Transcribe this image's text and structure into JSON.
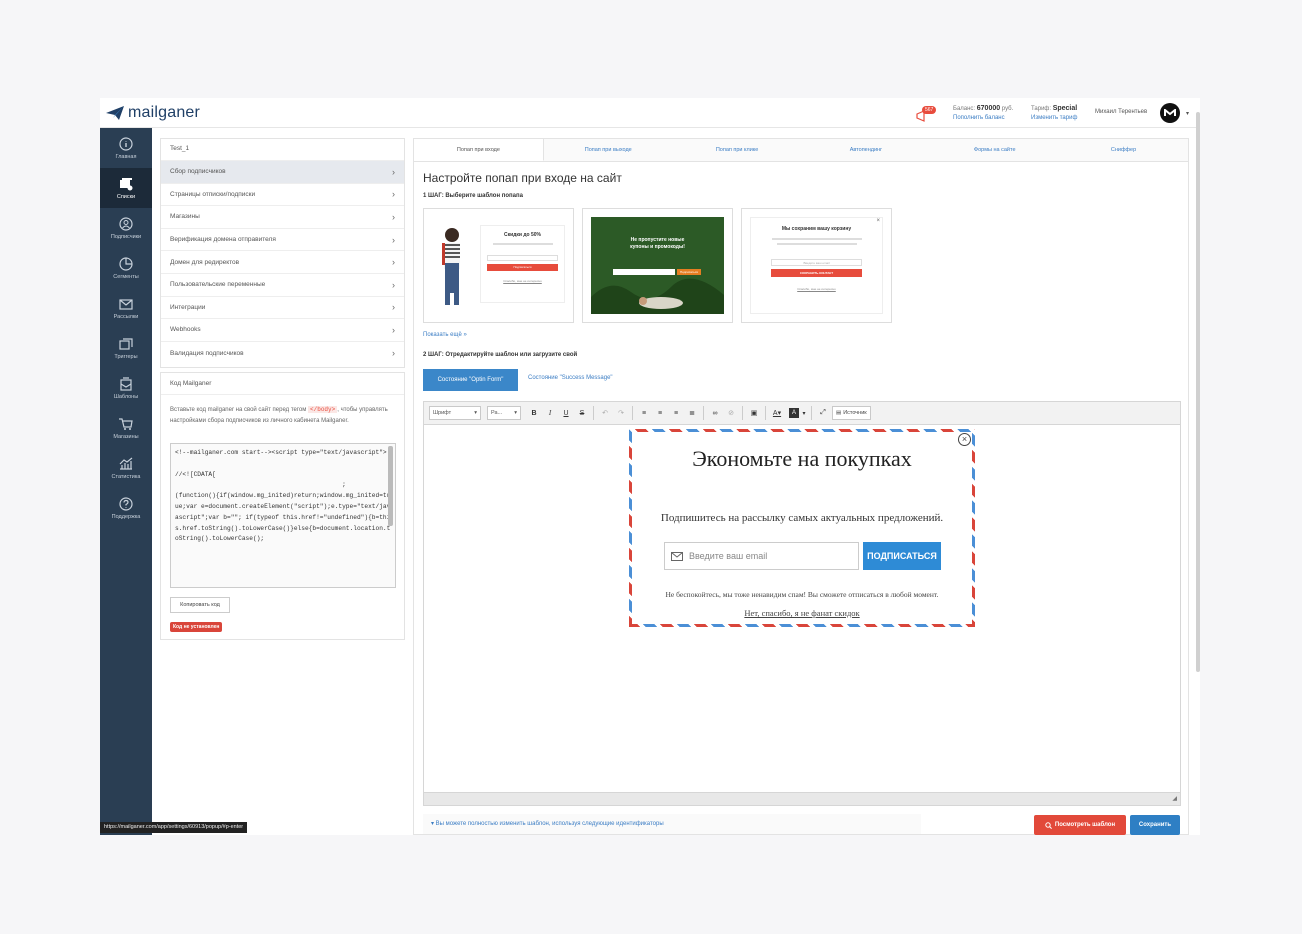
{
  "app": {
    "logo_text": "mailganer",
    "brand_color": "#1f3f66",
    "accent_color": "#3b87c9",
    "danger_color": "#e2493a"
  },
  "topbar": {
    "notification_badge": "567",
    "balance_label": "Баланс:",
    "balance_value": "670000",
    "balance_unit": "руб.",
    "balance_link": "Пополнить баланс",
    "tariff_label": "Тариф:",
    "tariff_value": "Special",
    "tariff_link": "Изменить тариф",
    "user_name": "Михаил Терентьев"
  },
  "sidebar": {
    "items": [
      {
        "label": "Главная",
        "icon": "info-icon"
      },
      {
        "label": "Списки",
        "icon": "lists-icon"
      },
      {
        "label": "Подписчики",
        "icon": "user-icon"
      },
      {
        "label": "Сегменты",
        "icon": "pie-icon"
      },
      {
        "label": "Рассылки",
        "icon": "mail-icon"
      },
      {
        "label": "Триггеры",
        "icon": "trigger-icon"
      },
      {
        "label": "Шаблоны",
        "icon": "template-icon"
      },
      {
        "label": "Магазины",
        "icon": "cart-icon"
      },
      {
        "label": "Статистика",
        "icon": "stats-icon"
      },
      {
        "label": "Поддержка",
        "icon": "help-icon"
      }
    ]
  },
  "left_panel": {
    "title": "Test_1",
    "items": [
      "Сбор подписчиков",
      "Страницы отписки/подписки",
      "Магазины",
      "Верификация домена отправителя",
      "Домен для редиректов",
      "Пользовательские переменные",
      "Интеграции",
      "Webhooks",
      "Валидация подписчиков"
    ]
  },
  "code_panel": {
    "title": "Код Mailganer",
    "desc_before": "Вставьте код mailganer на свой сайт перед тегом ",
    "desc_tag": "</body>",
    "desc_after": ", чтобы управлять настройками сбора подписчиков из личного кабинета Mailganer.",
    "code": "<!--mailganer.com start--><script type=\"text/javascript\">\n\n//<![CDATA[\n                                             ;\n(function(){if(window.mg_inited)return;window.mg_inited=true;var e=document.createElement(\"script\");e.type=\"text/javascript\";var b=\"\"; if(typeof this.href!=\"undefined\"){b=this.href.toString().toLowerCase()}else{b=document.location.toString().toLowerCase();",
    "copy_label": "Копировать код",
    "status_label": "Код не установлен"
  },
  "tabs": [
    "Попап при входе",
    "Попап при выходе",
    "Попап при клике",
    "Автопендинг",
    "Формы на сайте",
    "Сниффер"
  ],
  "main": {
    "title": "Настройте попап при входе на сайт",
    "step1": "1 ШАГ: Выберите шаблон попапа",
    "show_more": "Показать ещё",
    "step2": "2 ШАГ: Отредактируйте шаблон или загрузите свой",
    "state_optin": "Состояние \"Optin Form\"",
    "state_success": "Состояние \"Success Message\"",
    "templates": [
      {
        "heading": "Скидки до 50%",
        "button": "Подписаться",
        "link": "Спасибо, мне не интересно"
      },
      {
        "heading": "Не пропустите новые купоны и промокоды!",
        "button": "Подписаться"
      },
      {
        "heading": "Мы сохраним вашу корзину",
        "field": "Введите ваш email",
        "button": "СОХРАНИТЬ КОНТАКТ",
        "link": "Спасибо, мне не интересно"
      }
    ]
  },
  "toolbar": {
    "font_label": "Шрифт",
    "size_label": "Ра...",
    "source_label": "Источник"
  },
  "popup": {
    "title": "Экономьте на покупках",
    "subtitle": "Подпишитесь на рассылку самых актуальных предложений.",
    "email_placeholder": "Введите ваш email",
    "subscribe": "ПОДПИСАТЬСЯ",
    "note": "Не беспокойтесь, мы тоже ненавидим спам! Вы сможете отписаться в любой момент.",
    "decline": "Нет, спасибо, я не фанат скидок"
  },
  "footer": {
    "hint": "▾ Вы можете полностью изменить шаблон, используя следующие идентификаторы",
    "preview_label": "Посмотреть шаблон",
    "save_label": "Сохранить"
  },
  "status_url": "https://mailganer.com/app/settings/60913/popup/#p-enter"
}
